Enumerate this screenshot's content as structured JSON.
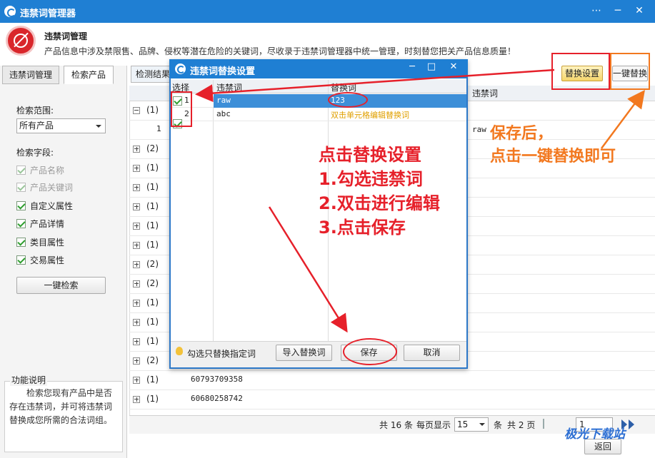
{
  "window": {
    "title": "违禁词管理器",
    "controls": [
      "⋯",
      "─",
      "✕"
    ]
  },
  "header": {
    "title": "违禁词管理",
    "description": "产品信息中涉及禁限售、品牌、侵权等潜在危险的关键词，尽收录于违禁词管理器中统一管理，时刻替您把关产品信息质量！"
  },
  "left": {
    "tabs": [
      "违禁词管理",
      "检索产品"
    ],
    "scope_label": "检索范围:",
    "scope_value": "所有产品",
    "fields_label": "检索字段:",
    "fields": [
      {
        "label": "产品名称",
        "checked": true,
        "disabled": true
      },
      {
        "label": "产品关键词",
        "checked": true,
        "disabled": true
      },
      {
        "label": "自定义属性",
        "checked": true,
        "disabled": false
      },
      {
        "label": "产品详情",
        "checked": true,
        "disabled": false
      },
      {
        "label": "类目属性",
        "checked": true,
        "disabled": false
      },
      {
        "label": "交易属性",
        "checked": true,
        "disabled": false
      }
    ],
    "search_button": "一键检索",
    "func_title": "功能说明",
    "func_text": "检索您现有产品中是否存在违禁词，并可将违禁词替换成您所需的合法词组。"
  },
  "main": {
    "tab": "检测结果",
    "col_header": "违禁词",
    "replace_settings_button": "替换设置",
    "one_click_replace_button": "一键替换",
    "rows": [
      {
        "count": "(1)",
        "expanded": true
      },
      {
        "count": "1",
        "child": true,
        "word": "raw"
      },
      {
        "count": "(2)"
      },
      {
        "count": "(1)"
      },
      {
        "count": "(1)"
      },
      {
        "count": "(1)"
      },
      {
        "count": "(1)"
      },
      {
        "count": "(1)"
      },
      {
        "count": "(2)"
      },
      {
        "count": "(2)"
      },
      {
        "count": "(1)"
      },
      {
        "count": "(1)"
      },
      {
        "count": "(1)"
      },
      {
        "count": "(2)"
      },
      {
        "count": "(1)",
        "id": "60793709358"
      },
      {
        "count": "(1)",
        "id": "60680258742"
      }
    ],
    "pager": {
      "total_prefix": "共",
      "total": "16",
      "total_suffix": "条",
      "per_page_label": "每页显示",
      "per_page": "15",
      "per_page_suffix": "条",
      "pages_prefix": "共",
      "pages": "2",
      "pages_suffix": "页",
      "page": "1"
    },
    "back_button": "返回"
  },
  "dialog": {
    "title": "违禁词替换设置",
    "controls": [
      "─",
      "□",
      "✕"
    ],
    "columns": [
      "选择",
      "违禁词",
      "替换词"
    ],
    "rows": [
      {
        "num": "1",
        "word": "raw",
        "replacement": "123",
        "checked": true,
        "selected": true
      },
      {
        "num": "2",
        "word": "abc",
        "replacement": "双击单元格编辑替换词",
        "checked": true,
        "selected": false
      }
    ],
    "hint": "勾选只替换指定词",
    "import_button": "导入替换词",
    "save_button": "保存",
    "cancel_button": "取消"
  },
  "annotations": {
    "steps": [
      "点击替换设置",
      "1.勾选违禁词",
      "2.双击进行编辑",
      "3.点击保存"
    ],
    "after_save": [
      "保存后，",
      "点击一键替换即可"
    ],
    "colors": {
      "red": "#e6202a",
      "orange": "#f2781f"
    }
  },
  "watermark": "极光下载站"
}
